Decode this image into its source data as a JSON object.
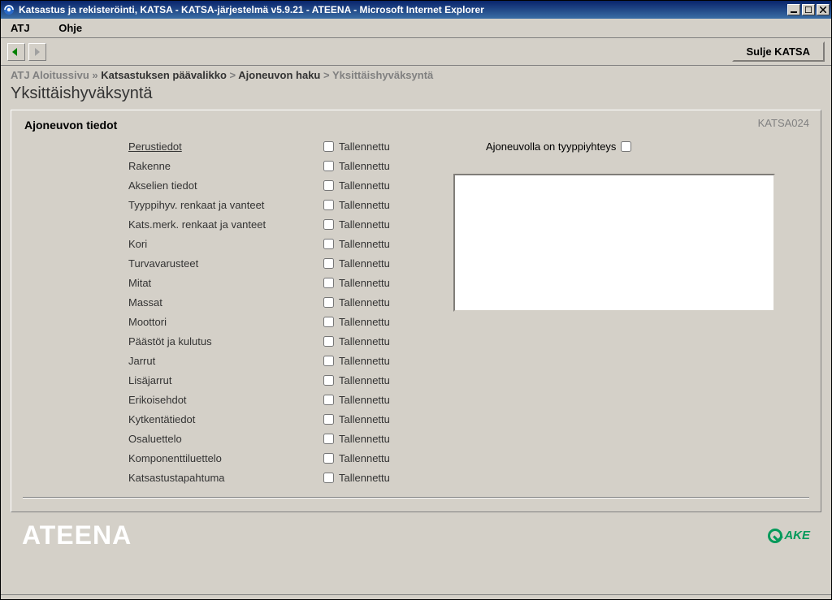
{
  "window": {
    "title": "Katsastus ja rekisteröinti, KATSA - KATSA-järjestelmä v5.9.21 - ATEENA - Microsoft Internet Explorer"
  },
  "menubar": {
    "atj": "ATJ",
    "ohje": "Ohje"
  },
  "toolbar": {
    "close_label": "Sulje KATSA"
  },
  "breadcrumb": {
    "b1": "ATJ Aloitussivu",
    "sep1": " » ",
    "b2": "Katsastuksen päävalikko",
    "sep2": " > ",
    "b3": "Ajoneuvon haku",
    "sep3": " > ",
    "b4": "Yksittäishyväksyntä"
  },
  "page": {
    "title": "Yksittäishyväksyntä",
    "code": "KATSA024",
    "section_title": "Ajoneuvon tiedot",
    "typp_label": "Ajoneuvolla on tyyppiyhteys",
    "saved_label": "Tallennettu"
  },
  "items": [
    "Perustiedot",
    "Rakenne",
    "Akselien tiedot",
    "Tyyppihyv. renkaat ja vanteet",
    "Kats.merk. renkaat ja vanteet",
    "Kori",
    "Turvavarusteet",
    "Mitat",
    "Massat",
    "Moottori",
    "Päästöt ja kulutus",
    "Jarrut",
    "Lisäjarrut",
    "Erikoisehdot",
    "Kytkentätiedot",
    "Osaluettelo",
    "Komponenttiluettelo",
    "Katsastustapahtuma"
  ],
  "footer": {
    "brand": "ATEENA",
    "ake": "AKE"
  }
}
